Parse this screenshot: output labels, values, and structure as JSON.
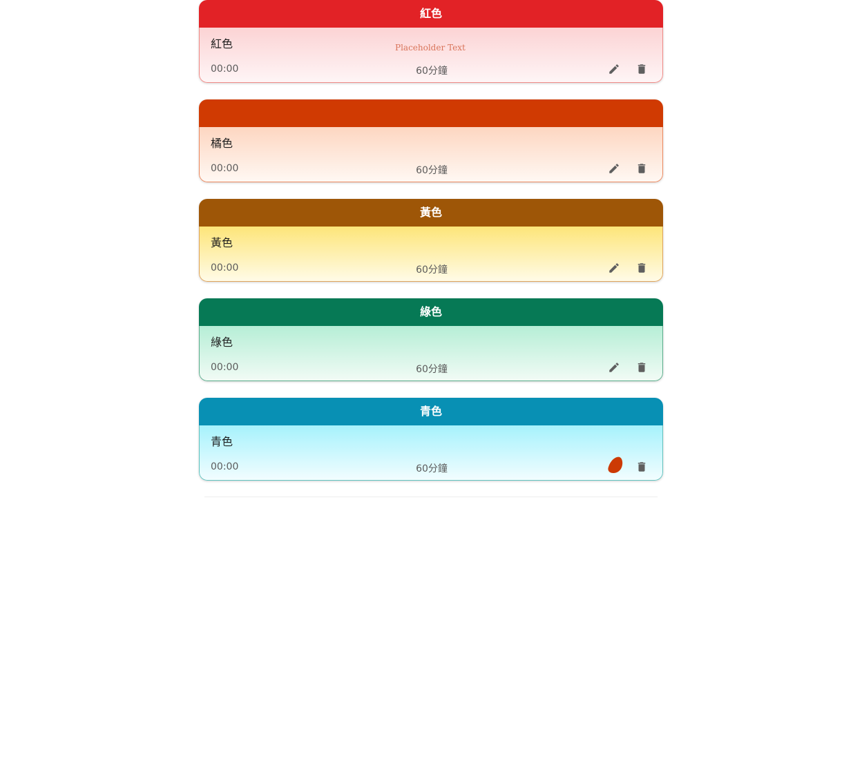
{
  "cards": [
    {
      "header": "紅色",
      "title": "紅色",
      "placeholder": "Placeholder Text",
      "time": "00:00",
      "duration": "60分鐘",
      "colors": {
        "header": "#e22226",
        "top": "#fcd3d4",
        "bottom": "#fef5f6",
        "border": "#f08b87"
      }
    },
    {
      "header": "",
      "title": "橘色",
      "time": "00:00",
      "duration": "60分鐘",
      "colors": {
        "header": "#d03a02",
        "top": "#fdd6c1",
        "bottom": "#fff8f3",
        "border": "#ec8a61"
      }
    },
    {
      "header": "黃色",
      "title": "黃色",
      "time": "00:00",
      "duration": "60分鐘",
      "colors": {
        "header": "#9e5607",
        "top": "#fde579",
        "bottom": "#fffbe7",
        "border": "#dfa45c"
      }
    },
    {
      "header": "綠色",
      "title": "綠色",
      "time": "00:00",
      "duration": "60分鐘",
      "colors": {
        "header": "#067955",
        "top": "#b6eed6",
        "bottom": "#f1fbf5",
        "border": "#5cae8d"
      }
    },
    {
      "header": "青色",
      "title": "青色",
      "time": "00:00",
      "duration": "60分鐘",
      "colors": {
        "header": "#0890b4",
        "top": "#a6f2fc",
        "bottom": "#f2fdff",
        "border": "#63c2be"
      }
    }
  ],
  "icons": {
    "edit": "pencil-icon",
    "delete": "trash-icon"
  },
  "blob_color": "#cc3a05"
}
